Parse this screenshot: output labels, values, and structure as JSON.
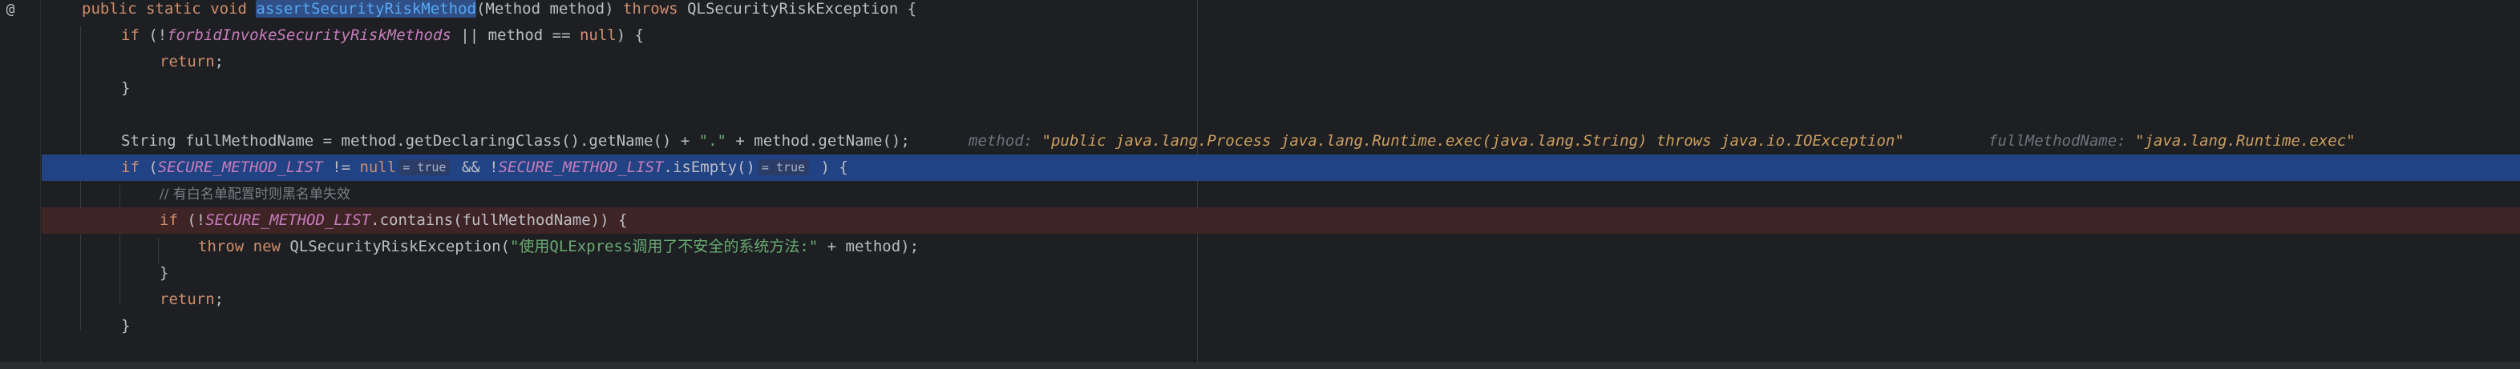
{
  "gutter": {
    "marker": "@"
  },
  "lines": {
    "l1": {
      "public": "public",
      "static": "static",
      "void": "void",
      "method_name": "assertSecurityRiskMethod",
      "params": "(Method method) ",
      "throws": "throws",
      "exception": " QLSecurityRiskException {"
    },
    "l2": {
      "if": "if",
      "open": " (!",
      "field": "forbidInvokeSecurityRiskMethods",
      "mid": " || method == ",
      "null": "null",
      "close": ") {"
    },
    "l3": {
      "return": "return",
      "semi": ";"
    },
    "l4": {
      "brace": "}"
    },
    "l5": {
      "code_a": "String fullMethodName = method.getDeclaringClass().getName() + ",
      "str": "\".\"",
      "code_b": " + method.getName();",
      "v1_name": "method: ",
      "v1_value": "\"public java.lang.Process java.lang.Runtime.exec(java.lang.String) throws java.io.IOException\"",
      "v2_name": "fullMethodName: ",
      "v2_value": "\"java.lang.Runtime.exec\""
    },
    "l6": {
      "if": "if",
      "open": " (",
      "field1": "SECURE_METHOD_LIST",
      "mid": " != ",
      "null": "null",
      "hint1": "= true",
      "and": " && !",
      "field2": "SECURE_METHOD_LIST",
      "call": ".isEmpty()",
      "hint2": "= true",
      "close": " ) {"
    },
    "l7": {
      "comment": "// 有白名单配置时则黑名单失效"
    },
    "l8": {
      "if": "if",
      "open": " (!",
      "field": "SECURE_METHOD_LIST",
      "rest": ".contains(fullMethodName)) {"
    },
    "l9": {
      "throw": "throw",
      "new": " new",
      "cls": " QLSecurityRiskException(",
      "str": "\"使用QLExpress调用了不安全的系统方法:\"",
      "rest": " + method);"
    },
    "l10": {
      "brace": "}"
    },
    "l11": {
      "return": "return",
      "semi": ";"
    },
    "l12": {
      "brace": "}"
    }
  },
  "colors": {
    "background": "#1e1f22",
    "selected_line": "#214283",
    "error_line": "#3f2426",
    "keyword": "#cf8e6d",
    "method": "#56a8f5",
    "static_field": "#c77dbb",
    "string": "#6aab73",
    "comment": "#7a7e85"
  }
}
